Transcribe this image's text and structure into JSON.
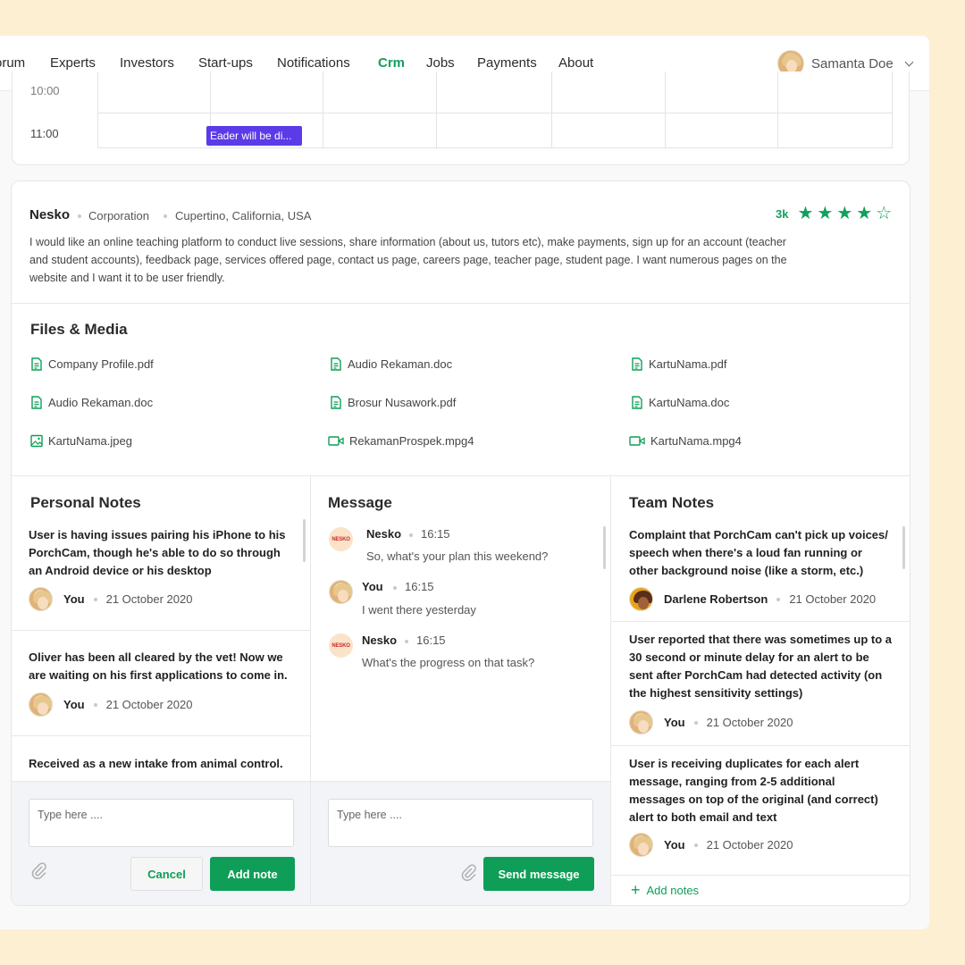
{
  "nav": {
    "items": [
      "orum",
      "Experts",
      "Investors",
      "Start-ups",
      "Notifications",
      "Crm",
      "Jobs",
      "Payments",
      "About"
    ],
    "active": "Crm",
    "user_name": "Samanta Doe"
  },
  "calendar": {
    "times": [
      "10:00",
      "11:00"
    ],
    "event": "Eader will be di..."
  },
  "client": {
    "name": "Nesko",
    "type": "Corporation",
    "location": "Cupertino, California, USA",
    "rating_count": "3k",
    "rating": 4,
    "rating_max": 5,
    "description": "I would like an online teaching platform to conduct live sessions, share information (about us, tutors etc), make payments, sign up for an account (teacher and student accounts), feedback page, services offered page, contact us page, careers page, teacher page, student page. I want numerous pages on the website and I want it to be user friendly."
  },
  "files": {
    "title": "Files & Media",
    "items": [
      {
        "name": "Company Profile.pdf",
        "icon": "document-icon"
      },
      {
        "name": "Audio Rekaman.doc",
        "icon": "document-icon"
      },
      {
        "name": "KartuNama.pdf",
        "icon": "document-icon"
      },
      {
        "name": "Audio Rekaman.doc",
        "icon": "document-icon"
      },
      {
        "name": "Brosur Nusawork.pdf",
        "icon": "document-icon"
      },
      {
        "name": "KartuNama.doc",
        "icon": "document-icon"
      },
      {
        "name": "KartuNama.jpeg",
        "icon": "image-icon"
      },
      {
        "name": "RekamanProspek.mpg4",
        "icon": "video-icon"
      },
      {
        "name": "KartuNama.mpg4",
        "icon": "video-icon"
      }
    ]
  },
  "personal_notes": {
    "title": "Personal Notes",
    "notes": [
      {
        "text": "User is having issues pairing his iPhone to his PorchCam, though he's able to do so through an Android device or his desktop",
        "author": "You",
        "date": "21 October 2020"
      },
      {
        "text": "Oliver has been all cleared by the vet! Now we are waiting on his first applications to come in.",
        "author": "You",
        "date": "21 October 2020"
      },
      {
        "text": "Received as a new intake from animal control.",
        "author": "",
        "date": ""
      }
    ],
    "placeholder": "Type here ....",
    "cancel_label": "Cancel",
    "add_label": "Add note"
  },
  "messages": {
    "title": "Message",
    "items": [
      {
        "name": "Nesko",
        "time": "16:15",
        "text": "So, what's your plan this weekend?",
        "avatar_text": "NESKO"
      },
      {
        "name": "You",
        "time": "16:15",
        "text": "I went there yesterday",
        "avatar_text": ""
      },
      {
        "name": "Nesko",
        "time": "16:15",
        "text": "What's the progress on that task?",
        "avatar_text": "NESKO"
      }
    ],
    "placeholder": "Type here ....",
    "send_label": "Send message"
  },
  "team_notes": {
    "title": "Team Notes",
    "notes": [
      {
        "text": "Complaint that PorchCam can't pick up voices/ speech when there's a loud fan running or other background noise (like a storm, etc.)",
        "author": "Darlene Robertson",
        "date": "21 October 2020"
      },
      {
        "text": "User reported that there was sometimes up to a 30 second or minute delay for an alert to be sent after PorchCam had detected activity (on the highest sensitivity settings)",
        "author": "You",
        "date": "21 October 2020"
      },
      {
        "text": "User is receiving duplicates for each alert message, ranging from 2-5 additional messages on top of the original (and correct) alert to both email and text",
        "author": "You",
        "date": "21 October 2020"
      }
    ],
    "add_label": "Add notes"
  },
  "colors": {
    "accent": "#0f9e57",
    "event": "#5b3be8",
    "background": "#fdefd1"
  }
}
